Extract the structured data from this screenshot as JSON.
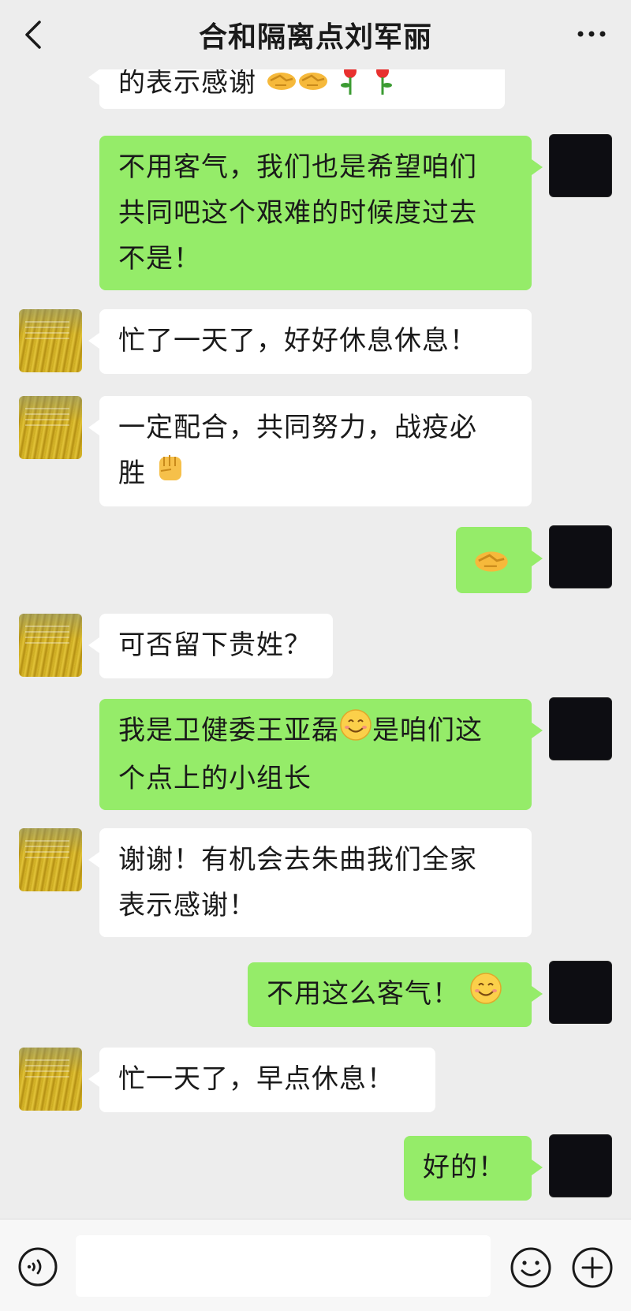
{
  "header": {
    "title": "合和隔离点刘军丽"
  },
  "messages": [
    {
      "from": "other",
      "text": "的表示感谢",
      "emojis": [
        "handshake-icon",
        "handshake-icon",
        "rose-icon",
        "rose-icon"
      ]
    },
    {
      "from": "self",
      "lines": [
        "不用客气，我们也是希望咱们",
        "共同吧这个艰难的时候度过去",
        "不是！"
      ]
    },
    {
      "from": "other",
      "text": "忙了一天了，好好休息休息！"
    },
    {
      "from": "other",
      "lines": [
        "一定配合，共同努力，战疫必",
        "胜"
      ],
      "emojis": [
        "raised-fist-icon"
      ]
    },
    {
      "from": "self",
      "emojis": [
        "handshake-icon"
      ]
    },
    {
      "from": "other",
      "text": "可否留下贵姓？"
    },
    {
      "from": "self",
      "line1a": "我是卫健委王亚磊",
      "line1b": "是咱们这",
      "line2": "个点上的小组长",
      "emojis": [
        "smile-icon"
      ]
    },
    {
      "from": "other",
      "lines": [
        "谢谢！有机会去朱曲我们全家",
        "表示感谢！"
      ]
    },
    {
      "from": "self",
      "text": "不用这么客气！",
      "emojis": [
        "smile-icon"
      ]
    },
    {
      "from": "other",
      "text": "忙一天了，早点休息！"
    },
    {
      "from": "self",
      "text": "好的！"
    }
  ],
  "composer": {
    "value": ""
  },
  "colors": {
    "incoming_bubble": "#ffffff",
    "outgoing_bubble": "#95ec69",
    "background": "#ededed"
  }
}
